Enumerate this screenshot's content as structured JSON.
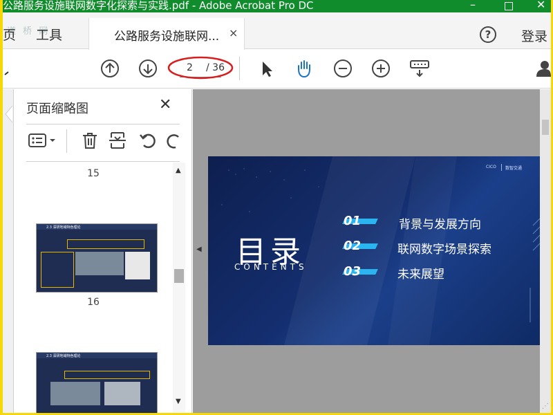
{
  "window": {
    "title": "公路服务设施联网数字化探索与实践.pdf - Adobe Acrobat Pro DC",
    "minimize": "–",
    "close": "✕"
  },
  "menu": {
    "home_partial": "页",
    "tools": "工具",
    "tab_label": "公路服务设施联网...",
    "tab_close": "×",
    "help": "?",
    "login": "登录",
    "watermark": "道 桥 网"
  },
  "toolbar": {
    "current_page": "2",
    "total_pages": "/ 36",
    "annotation_color": "#d62020",
    "accent_color": "#1a73c8"
  },
  "panel": {
    "title": "页面缩略图",
    "close": "✕",
    "thumbnails": [
      {
        "label": "15"
      },
      {
        "label": "16",
        "header": "2.3 深研地域特色理论"
      },
      {
        "header": "2.3 深研地域特色理论"
      }
    ],
    "scroll_up": "▲",
    "scroll_down": "▼"
  },
  "document": {
    "collapse_arrow": "◀",
    "slide": {
      "title": "目录",
      "subtitle": "CONTENTS",
      "logo_left": "CICO",
      "logo_right": "数智交通",
      "items": [
        {
          "num": "01",
          "text": "背景与发展方向"
        },
        {
          "num": "02",
          "text": "联网数字场景探索"
        },
        {
          "num": "03",
          "text": "未来展望"
        }
      ]
    }
  }
}
